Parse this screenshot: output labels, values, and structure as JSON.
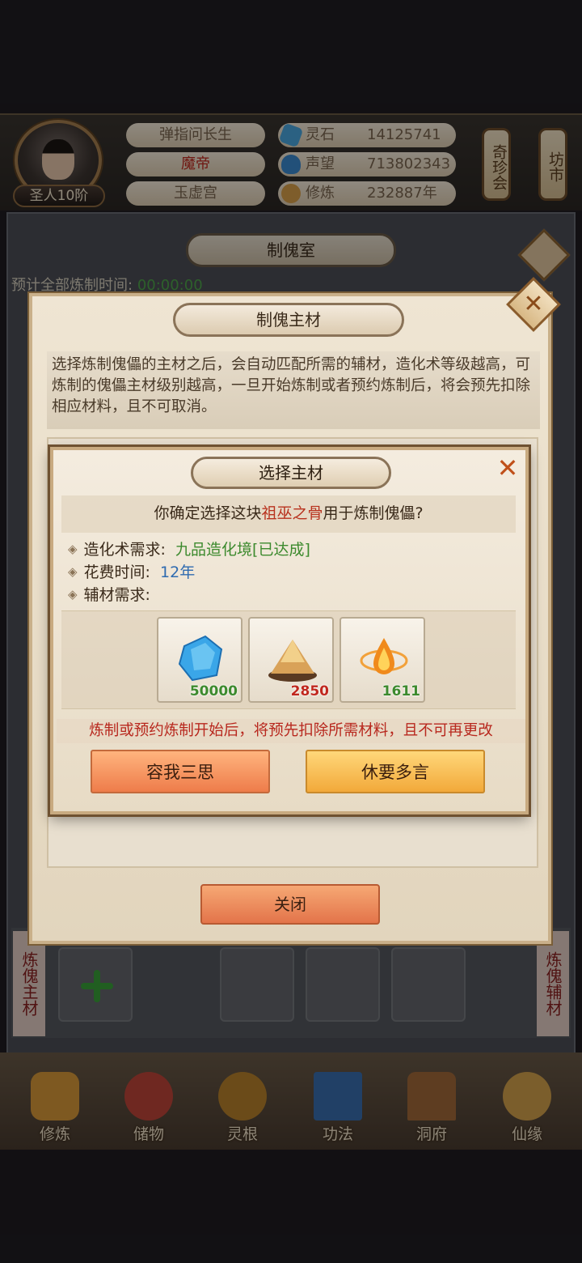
{
  "player": {
    "rank": "圣人10阶",
    "name_1": "弹指问长生",
    "name_2": "魔帝",
    "name_3": "玉虚宫"
  },
  "stats": [
    {
      "label": "灵石",
      "value": "14125741",
      "icon": "spirit-stone-icon",
      "color": "#4aa8e0"
    },
    {
      "label": "声望",
      "value": "713802343",
      "icon": "prestige-icon",
      "color": "#3c8ad0"
    },
    {
      "label": "修炼",
      "value": "232887年",
      "icon": "cultivation-icon",
      "color": "#d9a04a"
    }
  ],
  "side_tags": {
    "left": "奇珍会",
    "right": "坊市"
  },
  "background": {
    "title": "制傀室",
    "timer_label": "预计全部炼制时间:",
    "timer_value": "00:00:00",
    "slot_left_tag": "炼傀主材",
    "slot_right_tag": "炼傀辅材"
  },
  "bottom_nav": [
    {
      "label": "修炼",
      "icon": "cultivation-nav-icon",
      "color": "#d99a3a"
    },
    {
      "label": "储物",
      "icon": "storage-bag-icon",
      "color": "#c0463a"
    },
    {
      "label": "灵根",
      "icon": "spirit-root-icon",
      "color": "#b8822c"
    },
    {
      "label": "功法",
      "icon": "technique-book-icon",
      "color": "#3a6fb0"
    },
    {
      "label": "洞府",
      "icon": "cave-mansion-icon",
      "color": "#a36a3a"
    },
    {
      "label": "仙缘",
      "icon": "immortal-fate-icon",
      "color": "#d4a24c"
    }
  ],
  "dialog1": {
    "title": "制傀主材",
    "description": "选择炼制傀儡的主材之后，会自动匹配所需的辅材，造化术等级越高，可炼制的傀儡主材级别越高，一旦开始炼制或者预约炼制后，将会预先扣除相应材料，且不可取消。",
    "close_button": "关闭"
  },
  "dialog2": {
    "title": "选择主材",
    "close_symbol": "✕",
    "confirm_prefix": "你确定选择这块",
    "material_name": "祖巫之骨",
    "confirm_suffix": "用于炼制傀儡?",
    "req_skill_label": "造化术需求:",
    "req_skill_value": "九品造化境[已达成]",
    "req_time_label": "花费时间:",
    "req_time_value": "12年",
    "req_aux_label": "辅材需求:",
    "items": [
      {
        "count": "50000",
        "icon": "blue-spirit-stone-icon",
        "count_color": "#3d8a2e"
      },
      {
        "count": "2850",
        "icon": "golden-sand-pile-icon",
        "count_color": "#c0281e"
      },
      {
        "count": "1611",
        "icon": "fire-essence-drop-icon",
        "count_color": "#3d8a2e"
      }
    ],
    "warning": "炼制或预约炼制开始后，将预先扣除所需材料，且不可再更改",
    "cancel_label": "容我三思",
    "confirm_label": "休要多言"
  }
}
